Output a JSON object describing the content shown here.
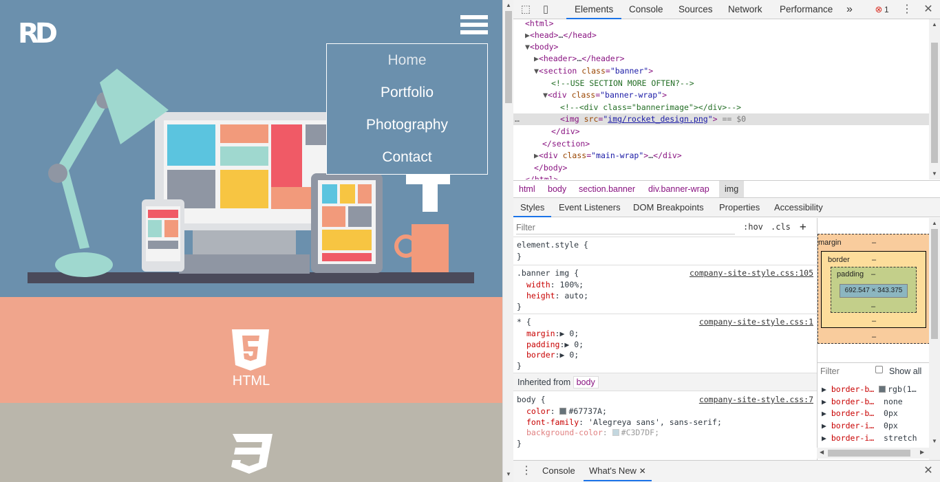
{
  "site": {
    "logo": "RD",
    "menu": [
      "Home",
      "Portfolio",
      "Photography",
      "Contact"
    ],
    "sections": [
      {
        "label": "HTML",
        "icon": "html5-icon"
      },
      {
        "label": "",
        "icon": "css3-icon"
      }
    ],
    "colors": {
      "banner": "#6b90ad",
      "html_section": "#f0a58c",
      "css_section": "#bab6ab"
    }
  },
  "devtools": {
    "tabs": [
      "Elements",
      "Console",
      "Sources",
      "Network",
      "Performance"
    ],
    "more_tabs": "»",
    "error_count": "1",
    "dom": [
      {
        "indent": 0,
        "toggle": "",
        "text": "<html>"
      },
      {
        "indent": 1,
        "toggle": "▶",
        "text": "<head>…</head>"
      },
      {
        "indent": 1,
        "toggle": "▼",
        "text": "<body>"
      },
      {
        "indent": 2,
        "toggle": "▶",
        "text": "<header>…</header>"
      },
      {
        "indent": 2,
        "toggle": "▼",
        "text": "<section class=\"banner\">"
      },
      {
        "indent": 3,
        "toggle": "",
        "text": "<!--USE SECTION MORE OFTEN?-->"
      },
      {
        "indent": 3,
        "toggle": "▼",
        "text": "<div class=\"banner-wrap\">"
      },
      {
        "indent": 4,
        "toggle": "",
        "text": "<!--<div class=\"bannerimage\"></div>-->"
      },
      {
        "indent": 4,
        "toggle": "",
        "text": "<img src=\"img/rocket_design.png\"> == $0"
      },
      {
        "indent": 3,
        "toggle": "",
        "text": "</div>"
      },
      {
        "indent": 2,
        "toggle": "",
        "text": "</section>"
      },
      {
        "indent": 2,
        "toggle": "▶",
        "text": "<div class=\"main-wrap\">…</div>"
      },
      {
        "indent": 1,
        "toggle": "",
        "text": "</body>"
      },
      {
        "indent": 0,
        "toggle": "",
        "text": "</html>"
      }
    ],
    "breadcrumbs": [
      "html",
      "body",
      "section.banner",
      "div.banner-wrap",
      "img"
    ],
    "subtabs": [
      "Styles",
      "Event Listeners",
      "DOM Breakpoints",
      "Properties",
      "Accessibility"
    ],
    "styles_filter_placeholder": "Filter",
    "hov": ":hov",
    "cls": ".cls",
    "plus": "+",
    "rules": {
      "element_style": "element.style {",
      "banner_img": {
        "selector": ".banner img {",
        "source": "company-site-style.css:105",
        "props": [
          [
            "width",
            "100%;"
          ],
          [
            "height",
            "auto;"
          ]
        ]
      },
      "star": {
        "selector": "* {",
        "source": "company-site-style.css:1",
        "props": [
          [
            "margin",
            "0;"
          ],
          [
            "padding",
            "0;"
          ],
          [
            "border",
            "0;"
          ]
        ]
      },
      "inherited_label": "Inherited from",
      "inherited_from": "body",
      "body": {
        "selector": "body {",
        "source": "company-site-style.css:7",
        "color_prop": "color",
        "color_val": "#67737A;",
        "font_prop": "font-family",
        "font_val": "'Alegreya sans', sans-serif;",
        "bg_prop": "background-color",
        "bg_val": "#C3D7DF;"
      },
      "close_brace": "}"
    },
    "box_model": {
      "margin": "margin",
      "border": "border",
      "padding": "padding",
      "content": "692.547 × 343.375",
      "dash": "–"
    },
    "computed_filter_placeholder": "Filter",
    "show_all": "Show all",
    "computed": [
      {
        "name": "border-b…",
        "value": "rgb(1…"
      },
      {
        "name": "border-b…",
        "value": "none"
      },
      {
        "name": "border-b…",
        "value": "0px"
      },
      {
        "name": "border-i…",
        "value": "0px"
      },
      {
        "name": "border-i…",
        "value": "stretch"
      }
    ],
    "drawer_tabs": [
      "Console",
      "What's New"
    ]
  }
}
